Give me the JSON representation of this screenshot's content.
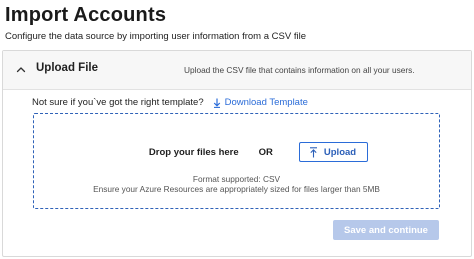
{
  "header": {
    "title": "Import Accounts",
    "subtitle": "Configure the data source by importing user information from a CSV file"
  },
  "section": {
    "title": "Upload File",
    "description": "Upload the CSV file that contains information on all your users.",
    "expanded": true,
    "toggle_icon": "chevron-up-icon"
  },
  "template": {
    "question": "Not sure if you`ve got the right template?",
    "download_label": "Download Template",
    "download_icon": "download-arrow-icon"
  },
  "dropzone": {
    "drop_text": "Drop your files here",
    "or_text": "OR",
    "upload_label": "Upload",
    "upload_icon": "upload-icon",
    "format_text": "Format supported: CSV",
    "size_text": "Ensure your Azure Resources are appropriately sized for files larger than 5MB"
  },
  "footer": {
    "continue_label": "Save and continue",
    "continue_disabled": true
  },
  "colors": {
    "accent": "#2b6cd8",
    "dropzone_border": "#2f62b8",
    "disabled_button": "#b6c8ea",
    "header_bg": "#f7f7f7"
  }
}
